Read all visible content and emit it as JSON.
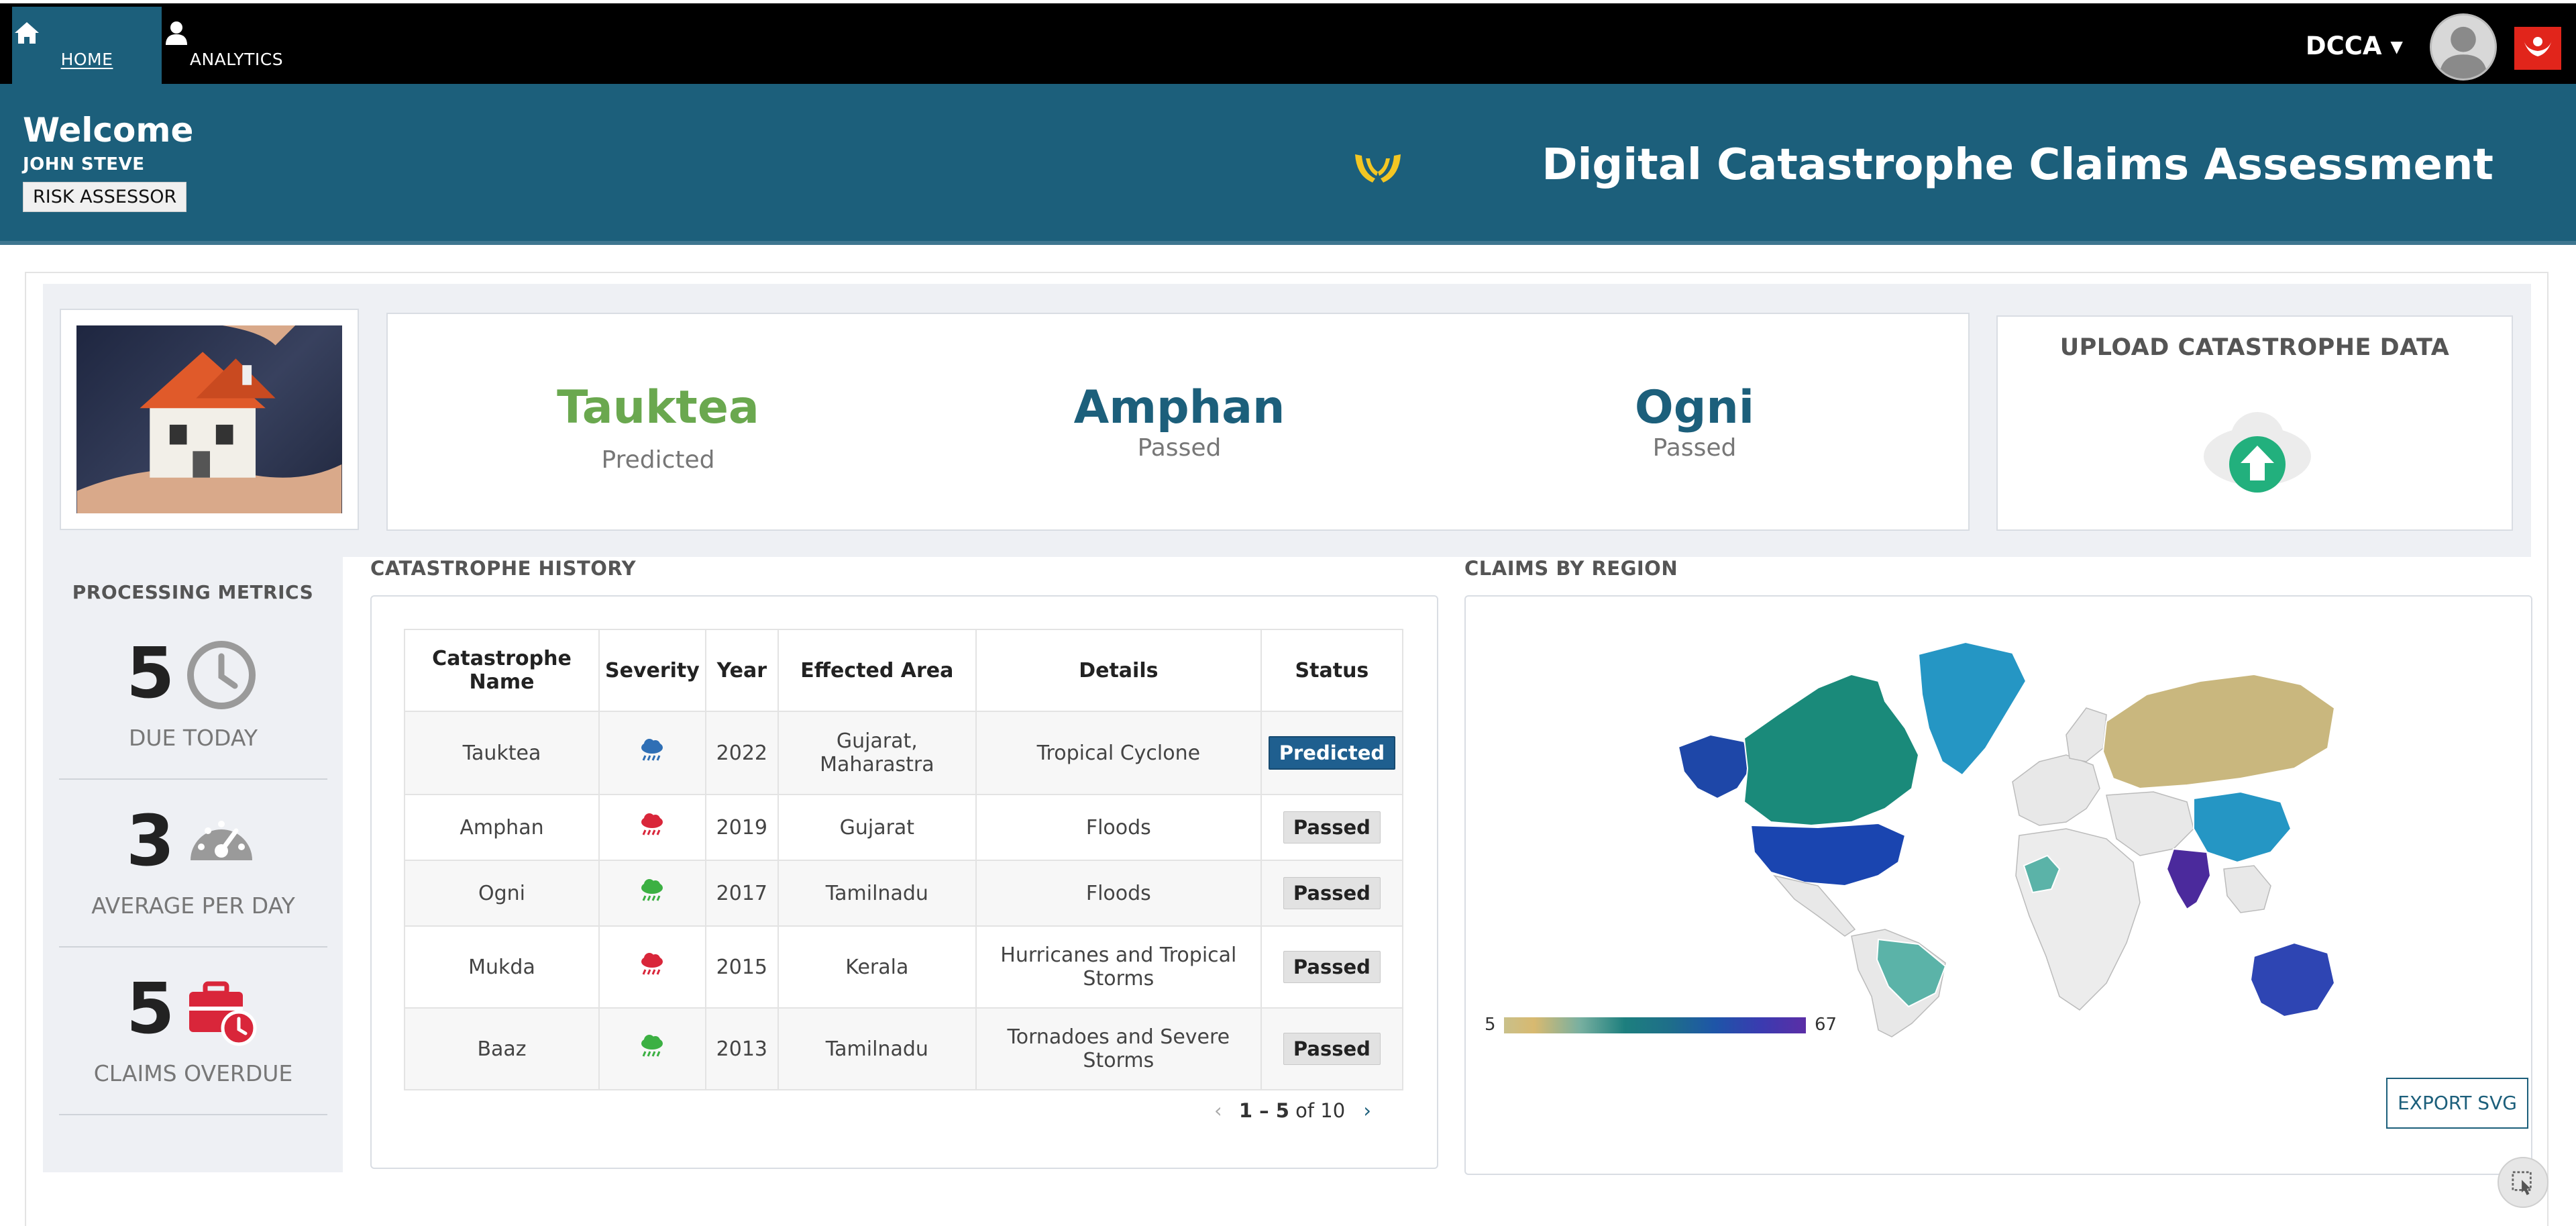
{
  "nav": {
    "home_label": "HOME",
    "analytics_label": "ANALYTICS",
    "user_menu": "DCCA ▾"
  },
  "banner": {
    "welcome": "Welcome",
    "user_name": "JOHN STEVE",
    "role": "RISK ASSESSOR",
    "app_title": "Digital Catastrophe Claims Assessment"
  },
  "summary": [
    {
      "name": "Tauktea",
      "status": "Predicted",
      "color": "#6aa84f"
    },
    {
      "name": "Amphan",
      "status": "Passed",
      "color": "#1c5f7b"
    },
    {
      "name": "Ogni",
      "status": "Passed",
      "color": "#1c5f7b"
    }
  ],
  "upload": {
    "title": "UPLOAD CATASTROPHE DATA"
  },
  "metrics": {
    "title": "PROCESSING METRICS",
    "items": [
      {
        "value": "5",
        "label": "DUE TODAY",
        "icon": "clock-icon"
      },
      {
        "value": "3",
        "label": "AVERAGE PER DAY",
        "icon": "gauge-icon"
      },
      {
        "value": "5",
        "label": "CLAIMS OVERDUE",
        "icon": "briefcase-clock-icon"
      }
    ]
  },
  "history": {
    "title": "CATASTROPHE HISTORY",
    "columns": [
      "Catastrophe Name",
      "Severity",
      "Year",
      "Effected Area",
      "Details",
      "Status"
    ],
    "rows": [
      {
        "name": "Tauktea",
        "severity": "blue",
        "year": "2022",
        "area": "Gujarat, Maharastra",
        "details": "Tropical Cyclone",
        "status": "Predicted"
      },
      {
        "name": "Amphan",
        "severity": "red",
        "year": "2019",
        "area": "Gujarat",
        "details": "Floods",
        "status": "Passed"
      },
      {
        "name": "Ogni",
        "severity": "green",
        "year": "2017",
        "area": "Tamilnadu",
        "details": "Floods",
        "status": "Passed"
      },
      {
        "name": "Mukda",
        "severity": "red",
        "year": "2015",
        "area": "Kerala",
        "details": "Hurricanes and Tropical Storms",
        "status": "Passed"
      },
      {
        "name": "Baaz",
        "severity": "green",
        "year": "2013",
        "area": "Tamilnadu",
        "details": "Tornadoes and Severe Storms",
        "status": "Passed"
      }
    ],
    "pager": {
      "range": "1 – 5",
      "of_text": "of 10"
    }
  },
  "region": {
    "title": "CLAIMS BY REGION",
    "legend_min": "5",
    "legend_max": "67",
    "export_label": "EXPORT SVG"
  },
  "colors": {
    "nav_bg": "#000000",
    "banner_bg": "#1c5f7b",
    "accent_green": "#6aa84f",
    "severity_blue": "#2f6fb5",
    "severity_red": "#d9263a",
    "severity_green": "#3cb043"
  }
}
